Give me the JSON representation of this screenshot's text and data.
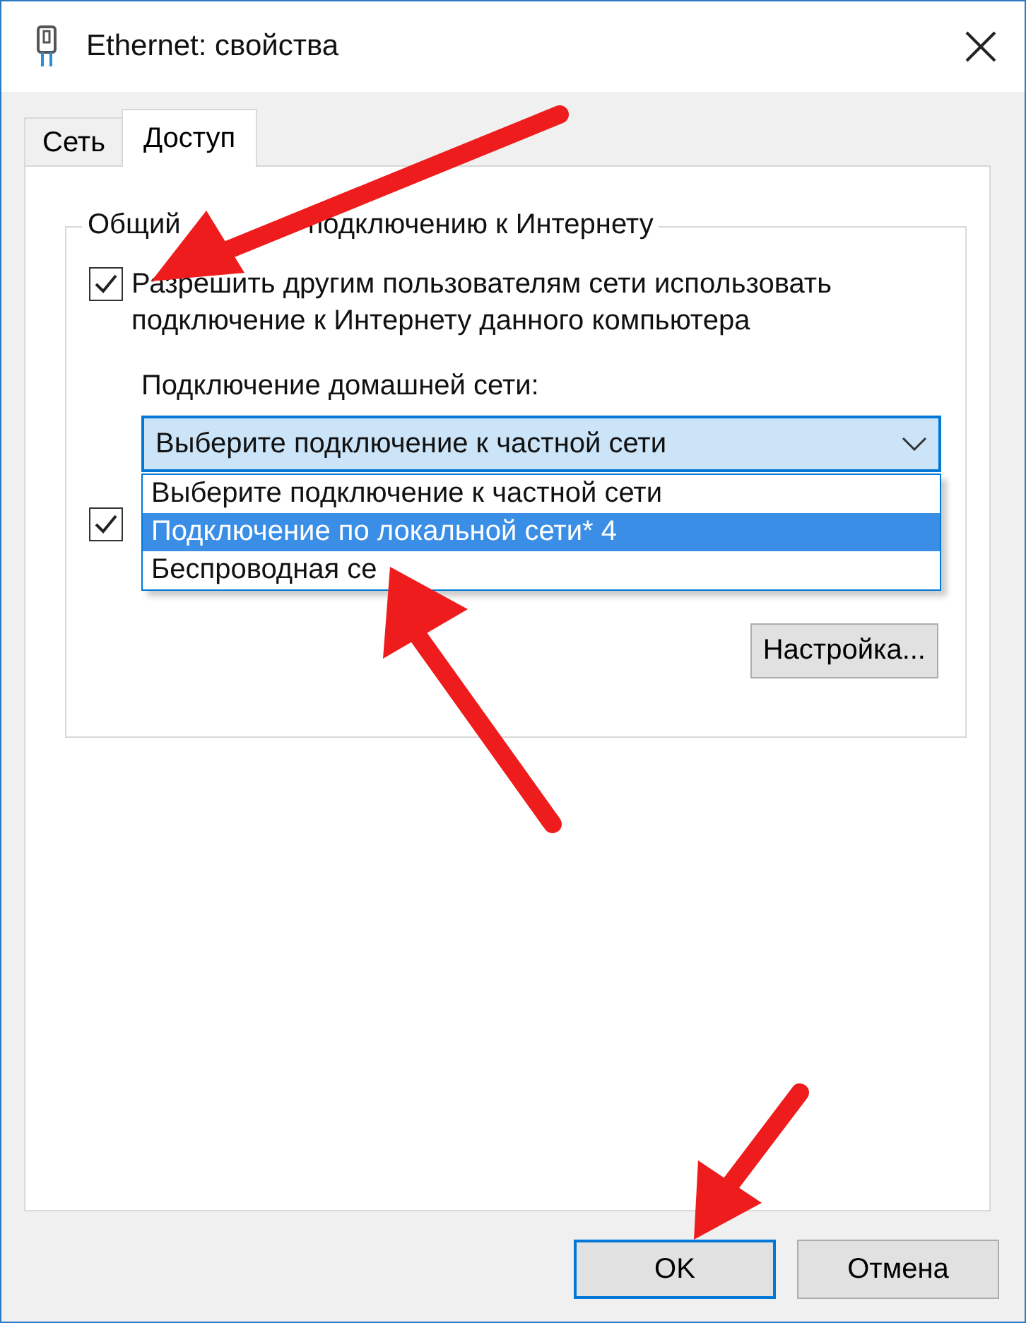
{
  "window": {
    "title": "Ethernet: свойства"
  },
  "tabs": [
    {
      "label": "Сеть",
      "selected": false
    },
    {
      "label": "Доступ",
      "selected": true
    }
  ],
  "sharing": {
    "title_parts": [
      "Общий",
      "подключению к Интернету"
    ],
    "options": [
      {
        "label": "Разрешить другим пользователям сети использовать подключение к Интернету данного компьютера",
        "checked": true
      },
      {
        "checked": true
      }
    ],
    "home_network": {
      "label": "Подключение домашней сети:",
      "value": "Выберите подключение к частной сети",
      "expanded": true,
      "options": [
        {
          "label": "Выберите подключение к частной сети",
          "highlighted": false
        },
        {
          "label": "Подключение по локальной сети* 4",
          "highlighted": true
        },
        {
          "label": "Беспроводная се",
          "highlighted": false
        }
      ]
    },
    "settings_button": "Настройка..."
  },
  "buttons": [
    {
      "label": "OK",
      "default": true
    },
    {
      "label": "Отмена",
      "default": false
    }
  ]
}
